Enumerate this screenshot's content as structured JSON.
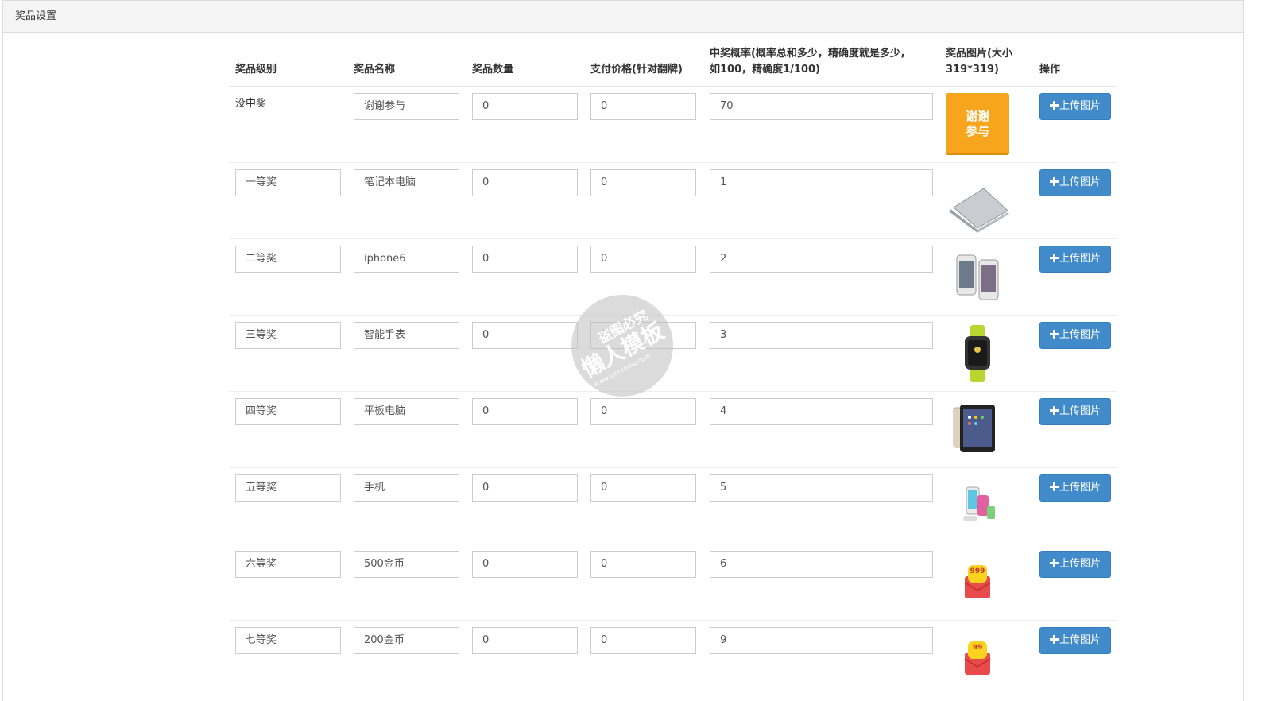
{
  "panel": {
    "title": "奖品设置"
  },
  "watermark": {
    "line1": "盗图必究",
    "line2": "懒人模板",
    "url": "www.lanrenmb.com"
  },
  "table": {
    "headers": {
      "level": "奖品级别",
      "name": "奖品名称",
      "quantity": "奖品数量",
      "price": "支付价格(针对翻牌)",
      "probability_line1": "中奖概率(概率总和多少，精确度就是多少，",
      "probability_line2": "如100，精确度1/100)",
      "image_line1": "奖品图片(大小",
      "image_line2": "319*319)",
      "action": "操作"
    },
    "upload_label": "上传图片",
    "upload_icon": "plus-icon",
    "rows": [
      {
        "level": "没中奖",
        "level_editable": false,
        "name": "谢谢参与",
        "quantity": "0",
        "price": "0",
        "probability": "70",
        "image": "thanks-participating",
        "image_text_1": "谢谢",
        "image_text_2": "参与"
      },
      {
        "level": "一等奖",
        "level_editable": true,
        "name": "笔记本电脑",
        "quantity": "0",
        "price": "0",
        "probability": "1",
        "image": "laptop"
      },
      {
        "level": "二等奖",
        "level_editable": true,
        "name": "iphone6",
        "quantity": "0",
        "price": "0",
        "probability": "2",
        "image": "iphone"
      },
      {
        "level": "三等奖",
        "level_editable": true,
        "name": "智能手表",
        "quantity": "0",
        "price": "0",
        "probability": "3",
        "image": "smartwatch"
      },
      {
        "level": "四等奖",
        "level_editable": true,
        "name": "平板电脑",
        "quantity": "0",
        "price": "0",
        "probability": "4",
        "image": "tablet"
      },
      {
        "level": "五等奖",
        "level_editable": true,
        "name": "手机",
        "quantity": "0",
        "price": "0",
        "probability": "5",
        "image": "phones"
      },
      {
        "level": "六等奖",
        "level_editable": true,
        "name": "500金币",
        "quantity": "0",
        "price": "0",
        "probability": "6",
        "image": "red-envelope",
        "image_text_1": "999"
      },
      {
        "level": "七等奖",
        "level_editable": true,
        "name": "200金币",
        "quantity": "0",
        "price": "0",
        "probability": "9",
        "image": "red-envelope",
        "image_text_1": "99"
      }
    ]
  }
}
